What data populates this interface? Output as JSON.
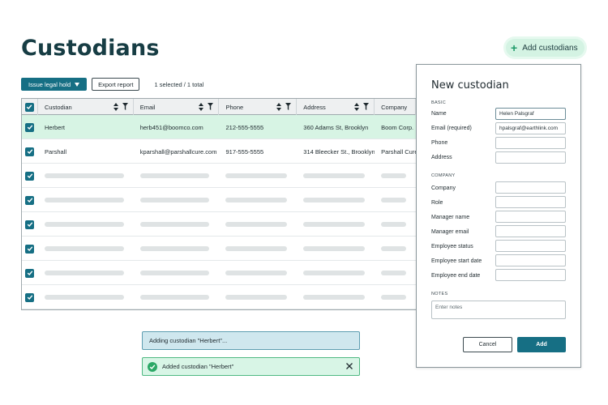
{
  "page": {
    "title": "Custodians"
  },
  "header": {
    "add_custodians_label": "Add custodians"
  },
  "toolbar": {
    "legal_hold_label": "Issue legal hold",
    "export_label": "Export report",
    "selection_text": "1 selected / 1 total"
  },
  "table": {
    "columns": [
      "Custodian",
      "Email",
      "Phone",
      "Address",
      "Company"
    ],
    "rows": [
      {
        "checked": true,
        "highlighted": true,
        "cells": [
          "Herbert",
          "herb451@boomco.com",
          "212-555-5555",
          "360 Adams St, Brooklyn",
          "Boom Corp."
        ]
      },
      {
        "checked": true,
        "highlighted": false,
        "cells": [
          "Parshall",
          "kparshall@parshallcure.com",
          "917-555-5555",
          "314 Bleecker St., Brooklyn",
          "Parshall Cure"
        ]
      }
    ],
    "placeholder_row_count": 6
  },
  "toasts": {
    "progress_text": "Adding custodian \"Herbert\"...",
    "success_text": "Added custodian \"Herbert\""
  },
  "panel": {
    "title": "New custodian",
    "basic_label": "BASIC",
    "name_label": "Name",
    "name_value": "Helen Palsgraf",
    "email_label": "Email (required)",
    "email_value": "hpalsgraf@earthlink.com",
    "phone_label": "Phone",
    "address_label": "Address",
    "company_section_label": "COMPANY",
    "company_label": "Company",
    "role_label": "Role",
    "manager_name_label": "Manager name",
    "manager_email_label": "Manager email",
    "employee_status_label": "Employee status",
    "employee_start_label": "Employee start date",
    "employee_end_label": "Employee end date",
    "notes_section_label": "NOTES",
    "notes_placeholder": "Enter notes",
    "cancel_label": "Cancel",
    "add_label": "Add"
  },
  "colors": {
    "brand_dark": "#173d44",
    "primary_button": "#166f84",
    "selected_row": "#d7f4e4",
    "success_green": "#2ba866",
    "info_blue_bg": "#cfe7ee"
  },
  "icons": [
    "plus-icon",
    "caret-down-icon",
    "checkbox-checked-icon",
    "sort-icon",
    "filter-icon",
    "check-circle-icon",
    "close-icon"
  ]
}
